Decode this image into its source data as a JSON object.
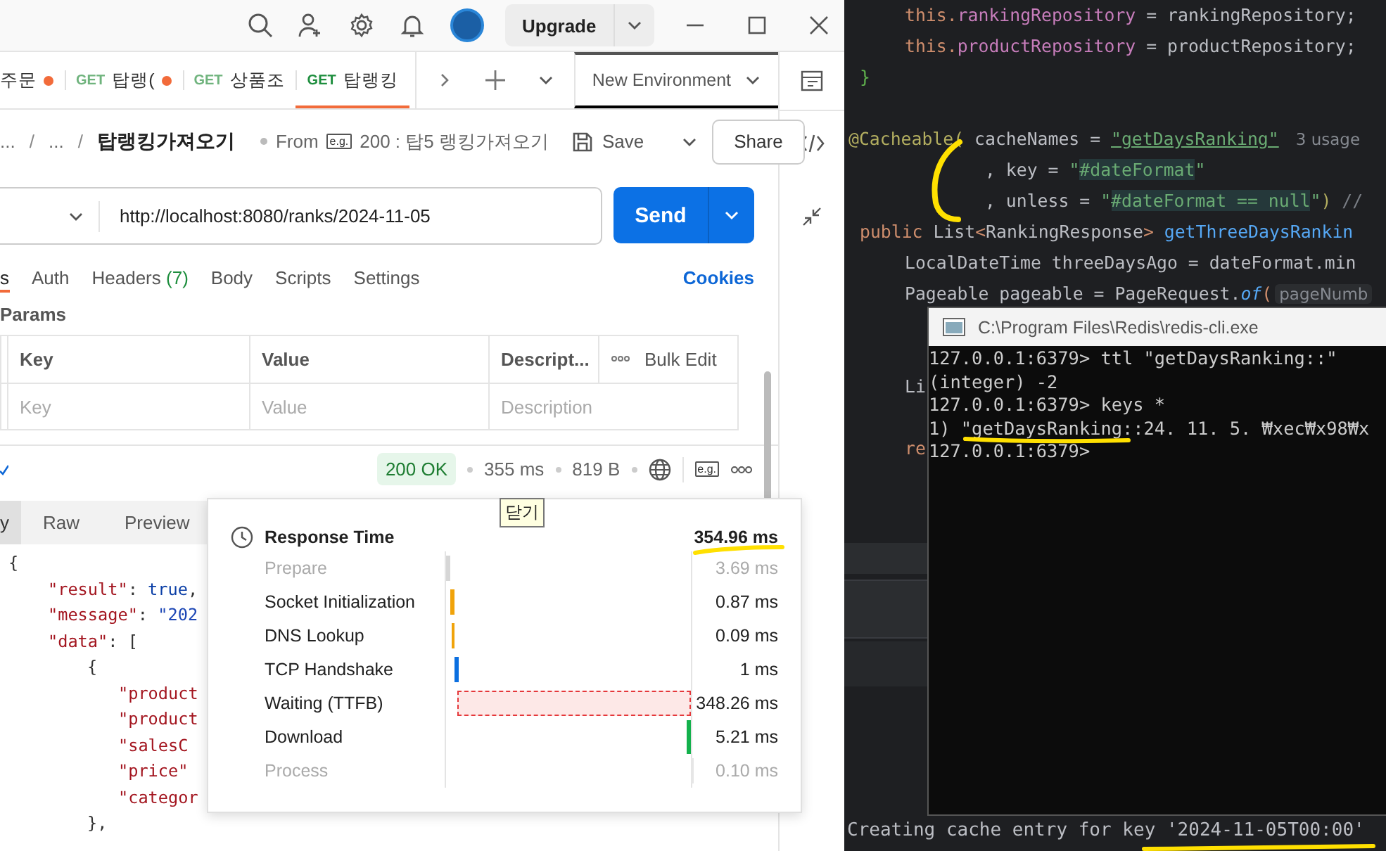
{
  "postman": {
    "upgrade": "Upgrade",
    "tabs": [
      {
        "label": "주문",
        "unsaved": true,
        "selected": false
      },
      {
        "method": "GET",
        "label": "탑랭(",
        "unsaved": true,
        "selected": false
      },
      {
        "method": "GET",
        "label": "상품조",
        "unsaved": false,
        "selected": false
      },
      {
        "method": "GET",
        "label": "탑랭킹",
        "unsaved": false,
        "selected": true
      }
    ],
    "environment": "New Environment",
    "breadcrumb": [
      {
        "text": "...",
        "kind": "link"
      },
      {
        "text": "/",
        "kind": "separator"
      },
      {
        "text": "...",
        "kind": "link"
      },
      {
        "text": "/",
        "kind": "separator"
      },
      {
        "text": "탑랭킹가져오기",
        "kind": "current"
      }
    ],
    "from": {
      "label": "From",
      "badge": "e.g.",
      "text": "200 : 탑5 랭킹가져오기"
    },
    "save": "Save",
    "share": "Share",
    "url": "http://localhost:8080/ranks/2024-11-05",
    "send": "Send",
    "request_tabs": [
      {
        "label": "s",
        "selected": true
      },
      {
        "label": "Auth",
        "selected": false
      },
      {
        "label": "Headers",
        "count": "(7)",
        "selected": false
      },
      {
        "label": "Body",
        "selected": false
      },
      {
        "label": "Scripts",
        "selected": false
      },
      {
        "label": "Settings",
        "selected": false
      }
    ],
    "cookies": "Cookies",
    "params_title": "Params",
    "params_table": {
      "columns": [
        "Key",
        "Value",
        "Descript..."
      ],
      "bulk_edit": "Bulk Edit",
      "placeholders": [
        "Key",
        "Value",
        "Description"
      ]
    },
    "response": {
      "status": "200 OK",
      "time": "355 ms",
      "size": "819 B",
      "badge": "e.g."
    },
    "response_tabs": [
      {
        "label": "y",
        "selected": true
      },
      {
        "label": "Raw",
        "selected": false
      },
      {
        "label": "Preview",
        "selected": false
      }
    ],
    "body_lines": [
      {
        "kind": "l0",
        "segments": [
          {
            "text": "{",
            "kind": "punct"
          }
        ]
      },
      {
        "kind": "l1",
        "segments": [
          {
            "text": "\"result\"",
            "kind": "key"
          },
          {
            "text": ": ",
            "kind": "punct"
          },
          {
            "text": "true",
            "kind": "bool"
          },
          {
            "text": ",",
            "kind": "punct"
          }
        ]
      },
      {
        "kind": "l1",
        "segments": [
          {
            "text": "\"message\"",
            "kind": "key"
          },
          {
            "text": ": ",
            "kind": "punct"
          },
          {
            "text": "\"202",
            "kind": "string"
          }
        ]
      },
      {
        "kind": "l1",
        "segments": [
          {
            "text": "\"data\"",
            "kind": "key"
          },
          {
            "text": ": ",
            "kind": "punct"
          },
          {
            "text": "[",
            "kind": "punct"
          }
        ]
      },
      {
        "kind": "l2",
        "segments": [
          {
            "text": "{",
            "kind": "punct"
          }
        ]
      },
      {
        "kind": "l3",
        "segments": [
          {
            "text": "\"product",
            "kind": "key"
          }
        ]
      },
      {
        "kind": "l3",
        "segments": [
          {
            "text": "\"product",
            "kind": "key"
          }
        ]
      },
      {
        "kind": "l3",
        "segments": [
          {
            "text": "\"salesC",
            "kind": "key"
          }
        ]
      },
      {
        "kind": "l3",
        "segments": [
          {
            "text": "\"price\"",
            "kind": "key"
          }
        ]
      },
      {
        "kind": "l3",
        "segments": [
          {
            "text": "\"categor",
            "kind": "key"
          }
        ]
      },
      {
        "kind": "l2",
        "segments": [
          {
            "text": "},",
            "kind": "punct"
          }
        ]
      }
    ],
    "timing": {
      "tooltip": "닫기",
      "title": "Response Time",
      "total": "354.96 ms",
      "phases": [
        {
          "name": "Prepare",
          "value": "3.69 ms",
          "muted": true,
          "color": "#d6d6d6"
        },
        {
          "name": "Socket Initialization",
          "value": "0.87 ms",
          "muted": false,
          "color": "#f0a30a"
        },
        {
          "name": "DNS Lookup",
          "value": "0.09 ms",
          "muted": false,
          "color": "#f0a30a"
        },
        {
          "name": "TCP Handshake",
          "value": "1 ms",
          "muted": false,
          "color": "#0b6fe0"
        },
        {
          "name": "Waiting (TTFB)",
          "value": "348.26 ms",
          "muted": false,
          "color": "#e5383b"
        },
        {
          "name": "Download",
          "value": "5.21 ms",
          "muted": false,
          "color": "#13b14c"
        },
        {
          "name": "Process",
          "value": "0.10 ms",
          "muted": true,
          "color": "#e6e6e6"
        }
      ]
    }
  },
  "ide": {
    "lines": [
      {
        "kind": "member",
        "segments": [
          {
            "text": "this.",
            "kind": "kw"
          },
          {
            "text": "rankingRepository",
            "kind": "field"
          },
          {
            "text": " = rankingRepository;",
            "kind": "plain"
          }
        ]
      },
      {
        "kind": "member",
        "segments": [
          {
            "text": "this.",
            "kind": "kw"
          },
          {
            "text": "productRepository",
            "kind": "field"
          },
          {
            "text": " = productRepository;",
            "kind": "plain"
          }
        ]
      },
      {
        "kind": "sig",
        "segments": [
          {
            "text": "}",
            "kind": "brace"
          }
        ]
      },
      {
        "kind": "blank"
      },
      {
        "kind": "top",
        "segments": [
          {
            "text": "@Cacheable(",
            "kind": "ann"
          },
          {
            "text": " cacheNames = ",
            "kind": "plain"
          },
          {
            "text": "\"getDaysRanking\"",
            "kind": "link"
          },
          {
            "text": "3 usage",
            "kind": "usage"
          }
        ]
      },
      {
        "kind": "cont",
        "segments": [
          {
            "text": ", key = ",
            "kind": "plain"
          },
          {
            "text": "\"",
            "kind": "str"
          },
          {
            "text": "#dateFormat",
            "kind": "spel"
          },
          {
            "text": "\"",
            "kind": "str"
          }
        ]
      },
      {
        "kind": "cont",
        "segments": [
          {
            "text": ", unless = ",
            "kind": "plain"
          },
          {
            "text": "\"",
            "kind": "str"
          },
          {
            "text": "#dateFormat == null",
            "kind": "spel"
          },
          {
            "text": "\"",
            "kind": "str"
          },
          {
            "text": ")",
            "kind": "ann"
          },
          {
            "text": " //",
            "kind": "comment"
          }
        ]
      },
      {
        "kind": "sig",
        "segments": [
          {
            "text": "public",
            "kind": "kw"
          },
          {
            "text": " List",
            "kind": "plain"
          },
          {
            "text": "<",
            "kind": "kw"
          },
          {
            "text": "RankingResponse",
            "kind": "plain"
          },
          {
            "text": ">",
            "kind": "kw"
          },
          {
            "text": "getThreeDaysRankin",
            "kind": "method"
          }
        ]
      },
      {
        "kind": "member",
        "segments": [
          {
            "text": "LocalDateTime threeDaysAgo = dateFormat.min",
            "kind": "plain"
          }
        ]
      },
      {
        "kind": "member",
        "segments": [
          {
            "text": "Pageable pageable = PageRequest.",
            "kind": "plain"
          },
          {
            "text": "of",
            "kind": "static"
          },
          {
            "text": "(",
            "kind": "kw"
          },
          {
            "text": "pageNumb",
            "kind": "hint"
          }
        ]
      },
      {
        "kind": "blank"
      },
      {
        "kind": "blank"
      },
      {
        "kind": "member",
        "segments": [
          {
            "text": "Li",
            "kind": "plain"
          }
        ]
      },
      {
        "kind": "blank"
      },
      {
        "kind": "member",
        "segments": [
          {
            "text": "re",
            "kind": "kw"
          }
        ]
      }
    ],
    "console": "Creating cache entry for key '2024-11-05T00:00'"
  },
  "terminal": {
    "title": "C:\\Program Files\\Redis\\redis-cli.exe",
    "lines": [
      "127.0.0.1:6379> ttl \"getDaysRanking::\"",
      "(integer) -2",
      "127.0.0.1:6379> keys *",
      "1) \"getDaysRanking::24. 11. 5. ₩xec₩x98₩x",
      "127.0.0.1:6379>"
    ]
  }
}
